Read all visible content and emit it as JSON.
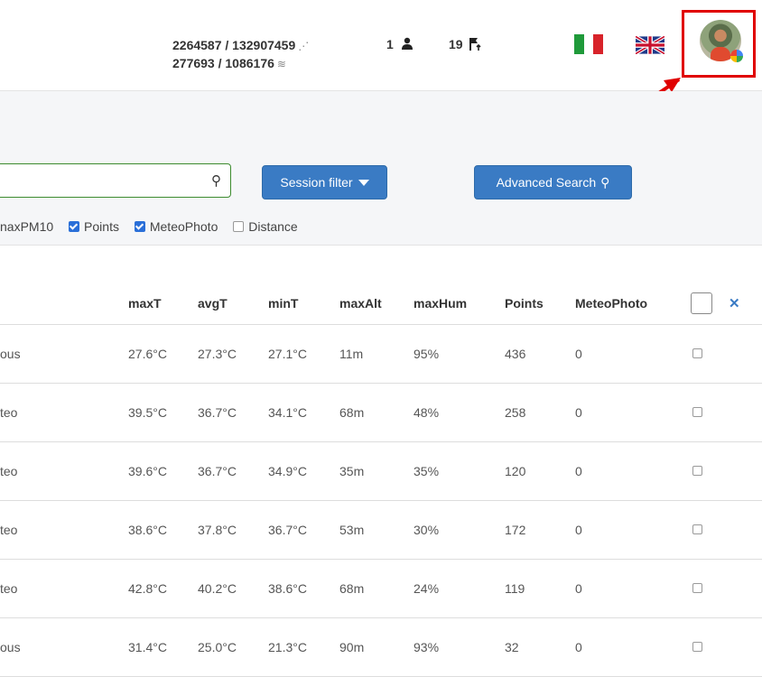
{
  "header": {
    "stats": {
      "line1": "2264587 / 132907459",
      "line1_icon": "satellite-icon",
      "line2": "277693 / 1086176",
      "line2_icon": "wind-icon"
    },
    "users_count": "1",
    "pending_count": "19",
    "languages": [
      "it",
      "en"
    ],
    "accent_color": "#e00000"
  },
  "filters": {
    "search": {
      "value": "",
      "placeholder": ""
    },
    "session_filter_label": "Session filter",
    "advanced_search_label": "Advanced Search",
    "checkboxes": [
      {
        "label": "naxPM10",
        "checked": false,
        "partial": true
      },
      {
        "label": "Points",
        "checked": true
      },
      {
        "label": "MeteoPhoto",
        "checked": true
      },
      {
        "label": "Distance",
        "checked": false
      }
    ]
  },
  "table": {
    "columns": [
      "",
      "maxT",
      "avgT",
      "minT",
      "maxAlt",
      "maxHum",
      "Points",
      "MeteoPhoto",
      ""
    ],
    "rows": [
      {
        "name": "ous",
        "maxT": "27.6°C",
        "avgT": "27.3°C",
        "minT": "27.1°C",
        "maxAlt": "11m",
        "maxHum": "95%",
        "points": "436",
        "photo": "0"
      },
      {
        "name": "teo",
        "maxT": "39.5°C",
        "avgT": "36.7°C",
        "minT": "34.1°C",
        "maxAlt": "68m",
        "maxHum": "48%",
        "points": "258",
        "photo": "0"
      },
      {
        "name": "teo",
        "maxT": "39.6°C",
        "avgT": "36.7°C",
        "minT": "34.9°C",
        "maxAlt": "35m",
        "maxHum": "35%",
        "points": "120",
        "photo": "0"
      },
      {
        "name": "teo",
        "maxT": "38.6°C",
        "avgT": "37.8°C",
        "minT": "36.7°C",
        "maxAlt": "53m",
        "maxHum": "30%",
        "points": "172",
        "photo": "0"
      },
      {
        "name": "teo",
        "maxT": "42.8°C",
        "avgT": "40.2°C",
        "minT": "38.6°C",
        "maxAlt": "68m",
        "maxHum": "24%",
        "points": "119",
        "photo": "0"
      },
      {
        "name": "ous",
        "maxT": "31.4°C",
        "avgT": "25.0°C",
        "minT": "21.3°C",
        "maxAlt": "90m",
        "maxHum": "93%",
        "points": "32",
        "photo": "0"
      }
    ]
  }
}
